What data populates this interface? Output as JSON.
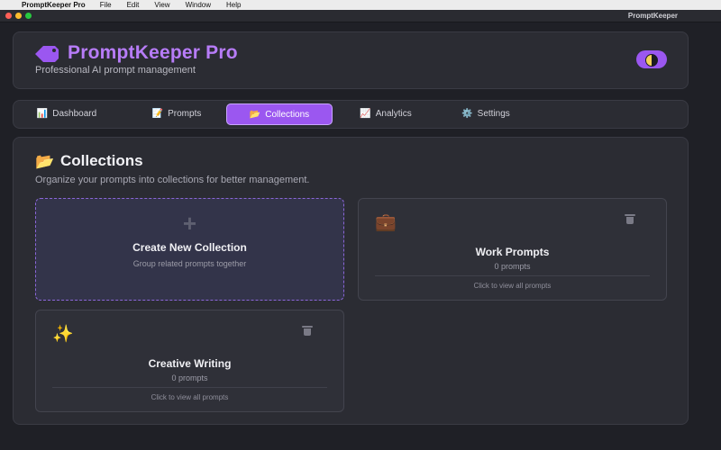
{
  "menubar": {
    "app_name": "PromptKeeper Pro",
    "items": [
      "File",
      "Edit",
      "View",
      "Window",
      "Help"
    ]
  },
  "window": {
    "title": "PromptKeeper"
  },
  "header": {
    "logo_icon": "tag-icon",
    "title": "PromptKeeper Pro",
    "subtitle": "Professional AI prompt management",
    "theme_toggle_icon": "half-moon-icon"
  },
  "nav": {
    "active": "Collections",
    "tabs": [
      {
        "icon": "📊",
        "label": "Dashboard"
      },
      {
        "icon": "📝",
        "label": "Prompts"
      },
      {
        "icon": "📂",
        "label": "Collections"
      },
      {
        "icon": "📈",
        "label": "Analytics"
      },
      {
        "icon": "⚙️",
        "label": "Settings"
      }
    ]
  },
  "main": {
    "icon": "📂",
    "title": "Collections",
    "description": "Organize your prompts into collections for better management.",
    "new_collection": {
      "plus": "+",
      "title": "Create New Collection",
      "subtitle": "Group related prompts together"
    },
    "collections": [
      {
        "icon": "💼",
        "name": "Work Prompts",
        "count": "0 prompts",
        "hint": "Click to view all prompts"
      },
      {
        "icon": "✨",
        "name": "Creative Writing",
        "count": "0 prompts",
        "hint": "Click to view all prompts"
      }
    ]
  },
  "colors": {
    "accent": "#9b57f0",
    "title": "#b77cf8",
    "background": "#1f2026",
    "panel": "#2b2c33"
  }
}
